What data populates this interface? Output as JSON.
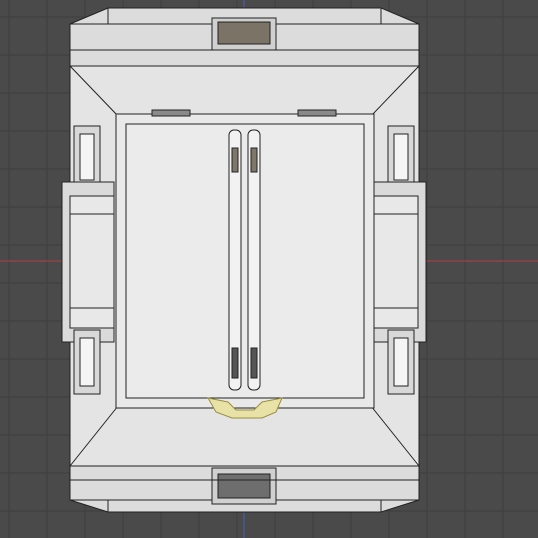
{
  "viewport": {
    "title": "",
    "background": "#4a4a4a",
    "grid_color": "#3e3e3e",
    "axis_x_color": "#b04040",
    "axis_y_color": "#4a5fb8",
    "model_fill": "#e6e6e6",
    "model_stroke": "#222222",
    "highlight_fill": "#e8e2a6"
  },
  "objects": {
    "cabinet": "cabinet-body",
    "door": "door-panel",
    "handle": "door-handle",
    "latch": "selected-latch-part"
  }
}
